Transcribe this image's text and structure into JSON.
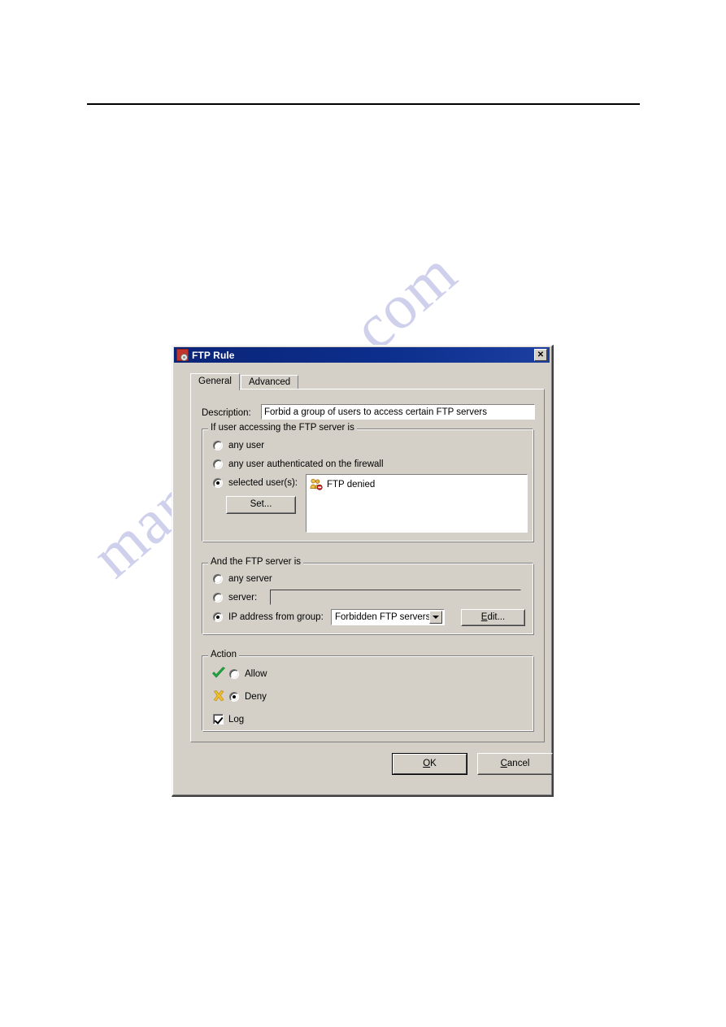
{
  "page": {
    "background": "#ffffff",
    "watermark_text": "manualshive.com",
    "watermark_color": "#9b9ed8"
  },
  "dialog": {
    "title": "FTP Rule",
    "title_icon": "ftp-rule-icon",
    "titlebar_color": "#0d2f8e",
    "close_label": "✕",
    "face_color": "#d4d0c8",
    "tabs": [
      {
        "label": "General",
        "selected": true
      },
      {
        "label": "Advanced",
        "selected": false
      }
    ],
    "description": {
      "label": "Description:",
      "value": "Forbid a group of users to access certain FTP servers",
      "placeholder": ""
    },
    "user_group": {
      "title": "If user accessing the FTP server is",
      "options": [
        {
          "label": "any user",
          "selected": false
        },
        {
          "label": "any user authenticated on the firewall",
          "selected": false
        },
        {
          "label": "selected user(s):",
          "selected": true
        }
      ],
      "set_button": "Set...",
      "list_items": [
        {
          "label": "FTP denied",
          "icon": "user-group-denied-icon"
        }
      ]
    },
    "server_group": {
      "title": "And the FTP server is",
      "options": [
        {
          "label": "any server",
          "selected": false
        },
        {
          "label": "server:",
          "selected": false
        },
        {
          "label": "IP address from group:",
          "selected": true
        }
      ],
      "server_value": "",
      "ip_group_value": "Forbidden FTP servers",
      "ip_group_options": [
        "Forbidden FTP servers"
      ],
      "edit_button": "Edit...",
      "edit_button_mnemonic": "E"
    },
    "action_group": {
      "title": "Action",
      "options": [
        {
          "label": "Allow",
          "selected": false,
          "icon": "green-check-icon"
        },
        {
          "label": "Deny",
          "selected": true,
          "icon": "yellow-x-icon"
        }
      ],
      "log": {
        "label": "Log",
        "checked": true
      }
    },
    "footer": {
      "ok_label": "OK",
      "ok_mnemonic": "O",
      "cancel_label": "Cancel",
      "cancel_mnemonic": "C"
    }
  }
}
